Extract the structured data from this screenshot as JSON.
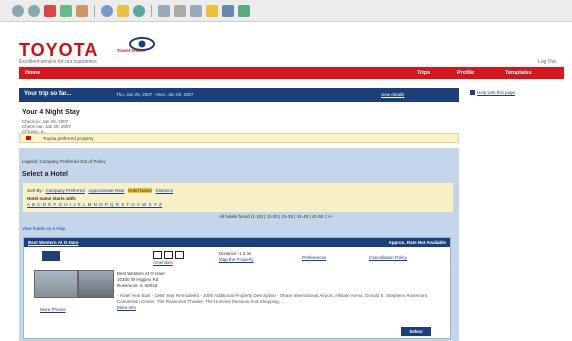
{
  "brand": {
    "logo": "TOYOTA",
    "sub": "Travel Vision",
    "tagline": "Excellent service for our customers",
    "logout": "Log Out"
  },
  "nav": {
    "home": "Home",
    "trips": "Trips",
    "profile": "Profile",
    "templates": "Templates"
  },
  "help": "Help with this page",
  "trip": {
    "title": "Your trip so far...",
    "dates": "Thu, Jan 25, 2007 - Mon, Jan 29, 2007",
    "view": "view details",
    "stay": "Your 4 Night Stay",
    "checkin": "Check-in: Jan 25, 2007",
    "checkout": "Check-out: Jan 29, 2007",
    "city": "Chicago, IL"
  },
  "preferred": "Toyota preferred property",
  "legend": "Legend:  Company Preferred  Out of Policy",
  "select_title": "Select a Hotel",
  "sort": {
    "label": "Sort By:",
    "company": "Company Preferred",
    "rate": "Approximate Rate",
    "name": "Hotel Name",
    "distance": "Distance",
    "starts": "Hotel name starts with:",
    "letters": "A  B  C  D  E  F  G  H  I  J  K  L  M  N  O  P  Q  R  S  T  U  V  W  X  Y  Z"
  },
  "found": "All hotels found (1-10) | 11-20 | 21-30 | 31-40 | 41-50 | >>",
  "map_link": "View hotels on a map",
  "hotel": {
    "name": "Best Western At O Hare",
    "availability": "Approx. Rate Not Available",
    "amenities": "Amenities",
    "distance": "Distance: 1.3 mi",
    "map": "Map the Property",
    "preferences": "Preferences",
    "policy": "Cancellation Policy",
    "addr1": "Best Western At O Hare",
    "addr2": "10300 W Higgins Rd",
    "addr3": "Rosemont, IL 60018",
    "desc": "- Hotel Year Built - 1965 Year Remodeled - 2005 Additional Property Description - Ohare International Airport, Allstate Arena, Donald E. Stephens Rosemont Convention Center, The Rosemont Theater, The Hummel Museum And Shopping, ...",
    "more": "More Info",
    "photos": "More Photos",
    "select": "Select"
  }
}
